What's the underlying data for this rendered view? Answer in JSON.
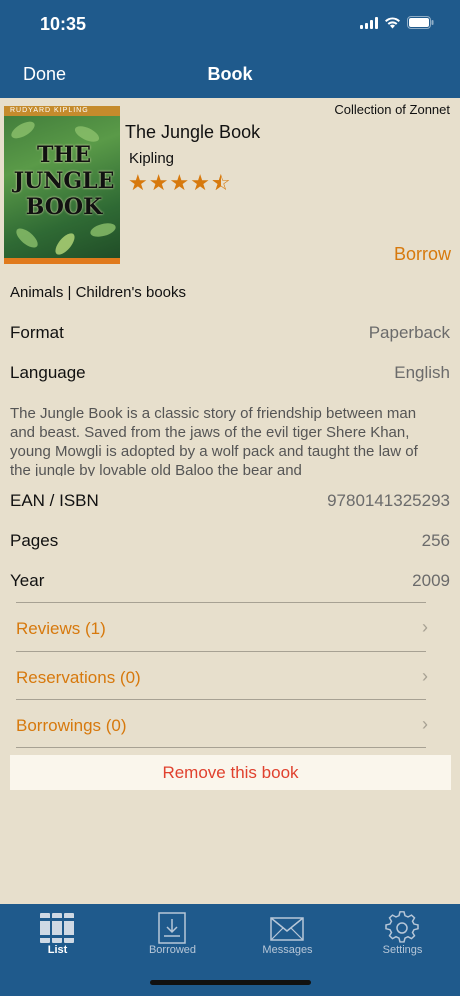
{
  "status": {
    "time": "10:35"
  },
  "nav": {
    "done_label": "Done",
    "title": "Book"
  },
  "book": {
    "collection": "Collection of Zonnet",
    "title": "The Jungle Book",
    "author": "Kipling",
    "rating": 4.5,
    "rating_max": 5,
    "borrow_label": "Borrow",
    "cover_author": "RUDYARD KIPLING",
    "cover_title": "THE JUNGLE BOOK",
    "categories": "Animals | Children's books",
    "description": "The Jungle Book is a classic story of friendship between man and beast. Saved from the jaws of the evil tiger Shere Khan, young Mowgli is adopted by a wolf pack and taught the law of the jungle by lovable old Baloo the bear and"
  },
  "details": [
    {
      "label": "Format",
      "value": "Paperback"
    },
    {
      "label": "Language",
      "value": "English"
    },
    {
      "label": "EAN / ISBN",
      "value": "9780141325293"
    },
    {
      "label": "Pages",
      "value": "256"
    },
    {
      "label": "Year",
      "value": "2009"
    }
  ],
  "links": [
    {
      "label": "Reviews (1)"
    },
    {
      "label": "Reservations (0)"
    },
    {
      "label": "Borrowings (0)"
    }
  ],
  "remove_label": "Remove this book",
  "tabs": [
    {
      "label": "List",
      "icon": "books-icon",
      "active": true
    },
    {
      "label": "Borrowed",
      "icon": "tray-download-icon",
      "active": false
    },
    {
      "label": "Messages",
      "icon": "envelope-icon",
      "active": false
    },
    {
      "label": "Settings",
      "icon": "gear-icon",
      "active": false
    }
  ],
  "colors": {
    "bar": "#1f5a8c",
    "accent": "#d7790d",
    "background": "#e7dfcc",
    "destructive": "#e0412e"
  }
}
